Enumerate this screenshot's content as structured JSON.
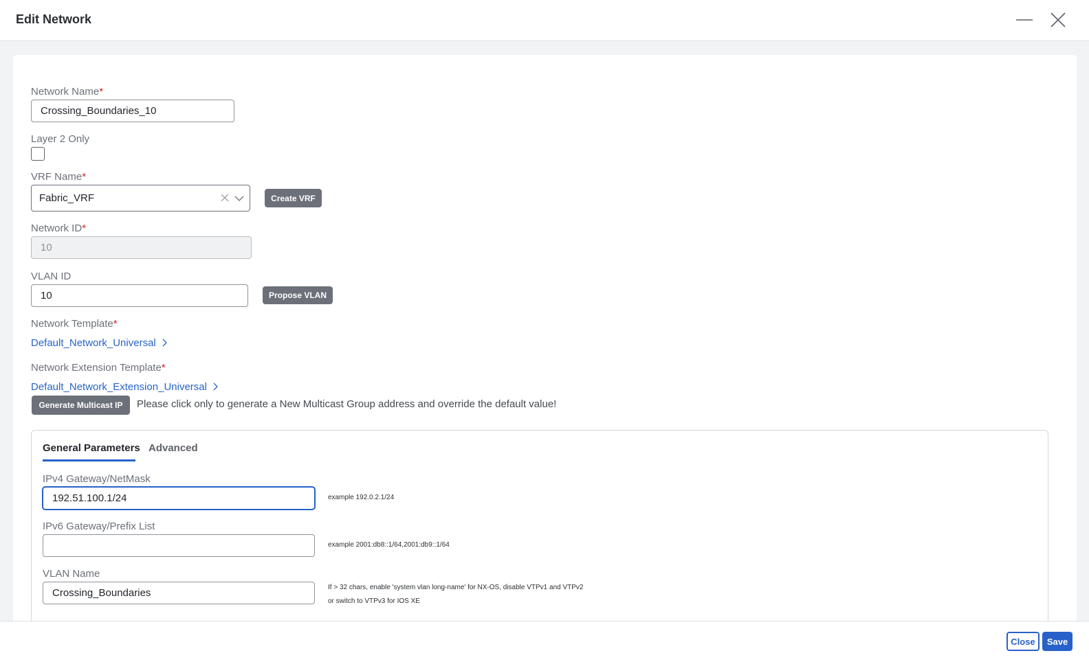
{
  "header": {
    "title": "Edit Network",
    "minimize_icon": "minimize-icon",
    "close_icon": "close-icon"
  },
  "form": {
    "network_name": {
      "label": "Network Name",
      "required_mark": "*",
      "value": "Crossing_Boundaries_10"
    },
    "layer2_only": {
      "label": "Layer 2 Only",
      "checked": false
    },
    "vrf_name": {
      "label": "VRF Name",
      "required_mark": "*",
      "value": "Fabric_VRF",
      "clear_icon": "clear-icon",
      "chevron_icon": "chevron-down-icon"
    },
    "create_vrf_button": "Create VRF",
    "network_id": {
      "label": "Network ID",
      "required_mark": "*",
      "value": "10"
    },
    "vlan_id": {
      "label": "VLAN ID",
      "value": "10"
    },
    "propose_vlan_button": "Propose VLAN",
    "network_template": {
      "label": "Network Template",
      "required_mark": "*",
      "link": "Default_Network_Universal"
    },
    "network_extension_template": {
      "label": "Network Extension Template",
      "required_mark": "*",
      "link": "Default_Network_Extension_Universal"
    },
    "generate_multicast_button": "Generate Multicast IP",
    "multicast_note": "Please click only to generate a New Multicast Group address and override the default value!"
  },
  "tabs": [
    {
      "label": "General Parameters",
      "active": true
    },
    {
      "label": "Advanced",
      "active": false
    }
  ],
  "general": {
    "ipv4": {
      "label": "IPv4 Gateway/NetMask",
      "value": "192.51.100.1/24",
      "hint": "example 192.0.2.1/24"
    },
    "ipv6": {
      "label": "IPv6 Gateway/Prefix List",
      "value": "",
      "hint": "example 2001:db8::1/64,2001:db9::1/64"
    },
    "vlan_name": {
      "label": "VLAN Name",
      "value": "Crossing_Boundaries",
      "hint_line1": "If > 32 chars, enable 'system vlan long-name' for NX-OS, disable VTPv1 and VTPv2",
      "hint_line2": "or switch to VTPv3 for IOS XE"
    }
  },
  "footer": {
    "close_button": "Close",
    "save_button": "Save"
  },
  "colors": {
    "accent": "#2761c9",
    "link": "#2764c5",
    "required": "#d81e24",
    "dark_button": "#6b7079"
  }
}
